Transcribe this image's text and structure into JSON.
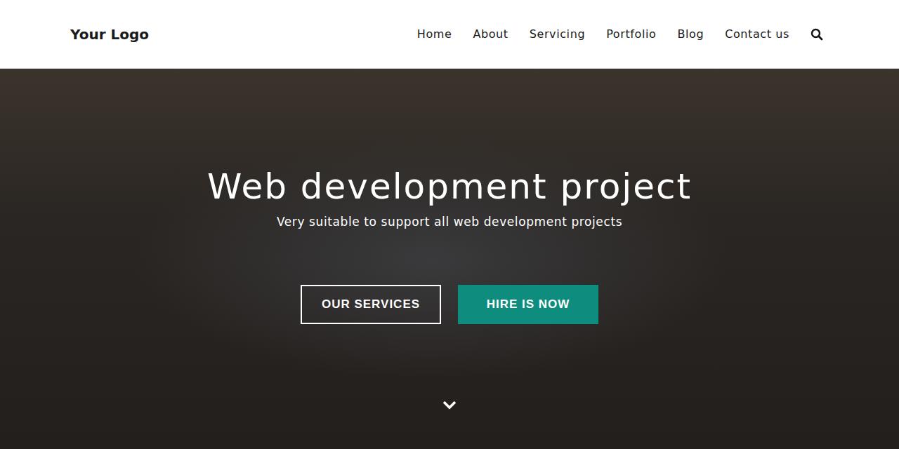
{
  "header": {
    "logo": "Your Logo",
    "nav": [
      {
        "label": "Home"
      },
      {
        "label": "About"
      },
      {
        "label": "Servicing"
      },
      {
        "label": "Portfolio"
      },
      {
        "label": "Blog"
      },
      {
        "label": "Contact us"
      }
    ]
  },
  "hero": {
    "title": "Web development project",
    "subtitle": "Very suitable to support all web development projects",
    "buttons": [
      {
        "label": "OUR SERVICES",
        "kind": "outline"
      },
      {
        "label": "HIRE IS NOW",
        "kind": "filled"
      }
    ]
  }
}
